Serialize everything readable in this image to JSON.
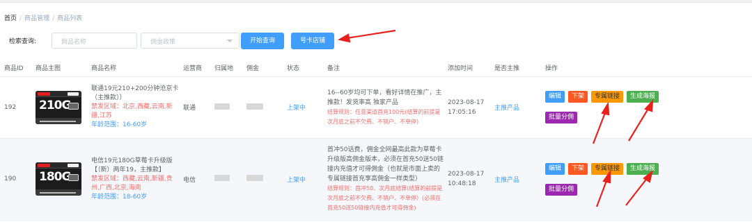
{
  "breadcrumb": {
    "home": "首页",
    "sep1": "/",
    "level2": "商品管理",
    "sep2": "/",
    "current": "商品列表"
  },
  "search": {
    "label": "检索查询:",
    "name_placeholder": "商品名称",
    "policy_placeholder": "佣金政策",
    "query_button": "开始查询",
    "shop_button": "号卡店铺"
  },
  "table": {
    "headers": [
      "商品ID",
      "商品主图",
      "商品名称",
      "运营商",
      "归属地",
      "佣金",
      "状态",
      "备注",
      "添加时间",
      "是否主推",
      "操作"
    ],
    "rows": [
      {
        "id": "192",
        "image": {
          "gb_text": "210G",
          "icon": "sim-card-icon"
        },
        "name": "联通19元210+200分钟沧京卡（主推款））",
        "restricted": "禁发区域：北京,西藏,云南,新疆,江苏",
        "age": "年龄范围：16-60岁",
        "operator": "联通",
        "status": "上架中",
        "remark_main": "16--60岁均可下单，看好详情在推广，主推款！发货率高 独家产品",
        "remark_rule": "结算规则：任意渠道首充100元(结算的前提是次月底之前不欠费、不销户、不单停)",
        "added_time": "2023-08-17 17:05:16",
        "featured": "主推产品",
        "actions": [
          "编辑",
          "下架",
          "专属链接",
          "生成海报",
          "批量分佣"
        ]
      },
      {
        "id": "190",
        "image": {
          "gb_text": "180G",
          "icon": "sim-card-icon"
        },
        "name": "电信19元180G草莓卡升级版【（新）两年19，主推款】",
        "restricted": "禁发区域：西藏,云南,新疆,贵州,广西,北京,海南",
        "age": "年龄范围：18-60岁",
        "operator": "电信",
        "status": "上架中",
        "remark_main": "首冲50话费，佣金全网最高此款为草莓卡升级版高佣金版本，必须在首充50送50链接内充值才可得佣金（也就是市面上卖的 专属链接首充享高佣金一样类型）",
        "remark_rule": "结算规则：首冲50、次月底结算(结算的前提是次月底之前不欠费、不销户、不单停）(必须在首充50送50链接内充值才可得佣金)",
        "added_time": "2023-08-17 10:48:18",
        "featured": "主推产品",
        "actions": [
          "编辑",
          "下架",
          "专属链接",
          "生成海报",
          "批量分佣"
        ]
      }
    ]
  },
  "colors": {
    "primary": "#409eff",
    "danger_text": "#f56c6c",
    "tag_down": "#ff5722",
    "tag_link": "#ff9800",
    "tag_poster": "#4caf50",
    "tag_split": "#9c27b0",
    "annotation_arrow": "#e8211c"
  }
}
